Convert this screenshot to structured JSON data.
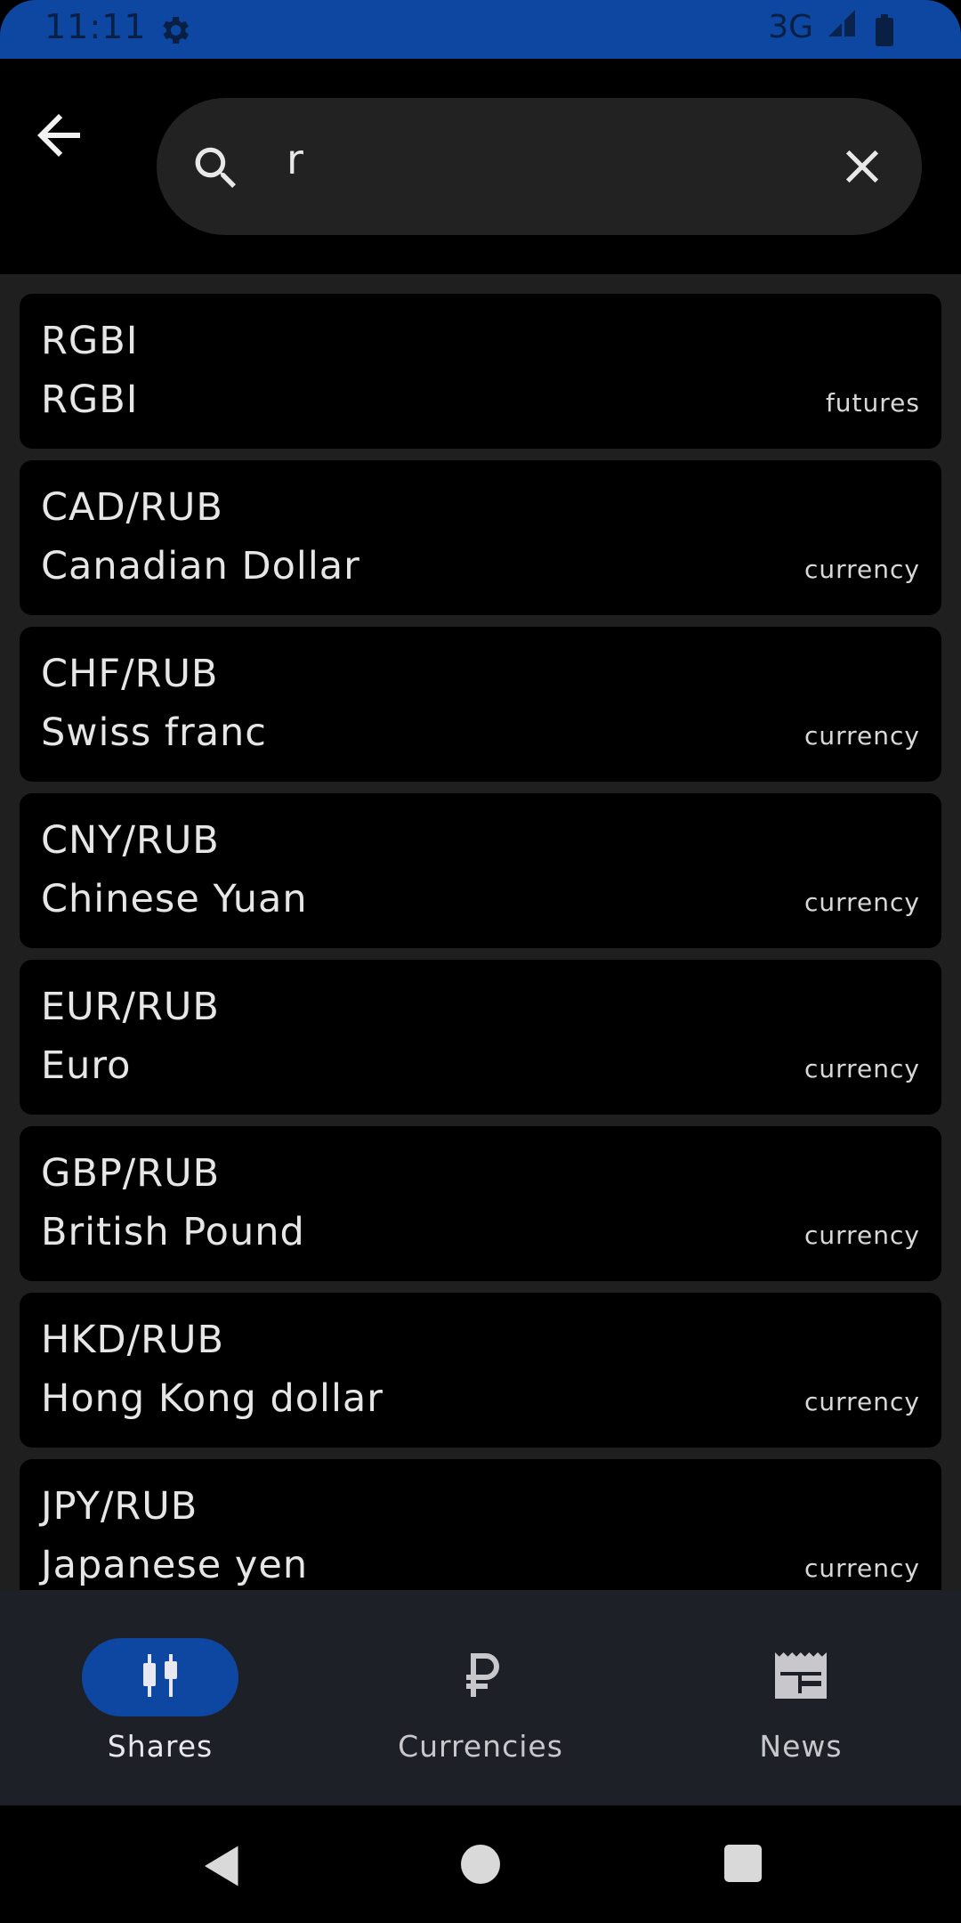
{
  "status_bar": {
    "time": "11:11",
    "network": "3G",
    "icons": [
      "settings-gear-icon",
      "signal-icon",
      "battery-icon"
    ]
  },
  "search": {
    "query": "r",
    "icons": [
      "back-arrow-icon",
      "search-icon",
      "clear-icon"
    ]
  },
  "results": [
    {
      "symbol": "RGBI",
      "name": "RGBI",
      "type": "futures"
    },
    {
      "symbol": "CAD/RUB",
      "name": "Canadian Dollar",
      "type": "currency"
    },
    {
      "symbol": "CHF/RUB",
      "name": "Swiss franc",
      "type": "currency"
    },
    {
      "symbol": "CNY/RUB",
      "name": "Chinese Yuan",
      "type": "currency"
    },
    {
      "symbol": "EUR/RUB",
      "name": "Euro",
      "type": "currency"
    },
    {
      "symbol": "GBP/RUB",
      "name": "British Pound",
      "type": "currency"
    },
    {
      "symbol": "HKD/RUB",
      "name": "Hong Kong dollar",
      "type": "currency"
    },
    {
      "symbol": "JPY/RUB",
      "name": "Japanese yen",
      "type": "currency"
    }
  ],
  "bottom_nav": {
    "items": [
      {
        "label": "Shares",
        "icon": "candlestick-icon",
        "active": true
      },
      {
        "label": "Currencies",
        "icon": "ruble-icon",
        "active": false
      },
      {
        "label": "News",
        "icon": "newspaper-icon",
        "active": false
      }
    ]
  },
  "colors": {
    "status_bar": "#0d47a1",
    "accent": "#0d47a1",
    "search_pill": "#222222",
    "list_bg": "#1f1f1f",
    "card_bg": "#000000",
    "nav_bg": "#1e2028"
  }
}
